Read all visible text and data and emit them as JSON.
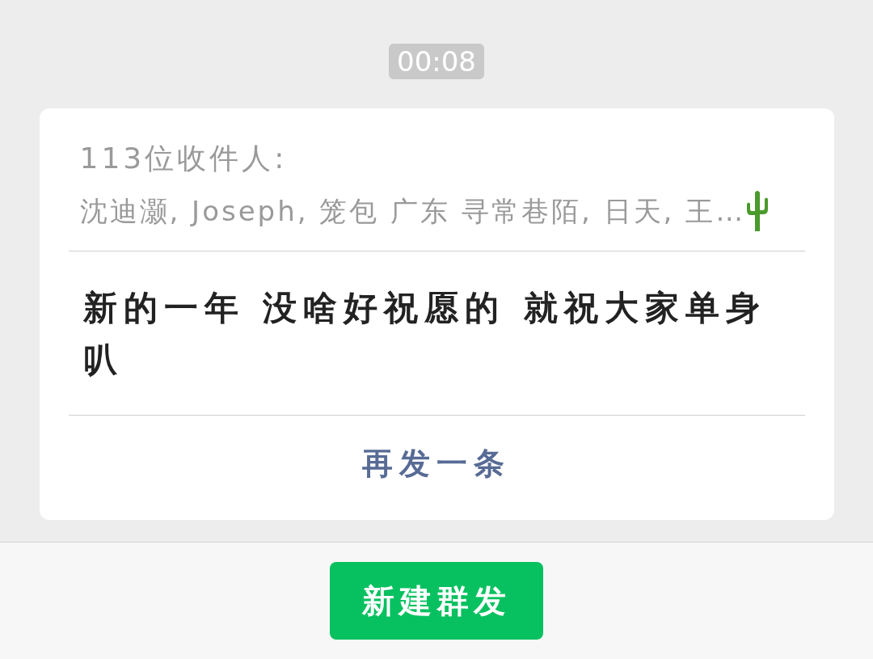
{
  "time": "00:08",
  "message_card": {
    "recipients_label": "113位收件人:",
    "recipients": "沈迪灏, Joseph, 笼包 广东 寻常巷陌, 日天, 王…",
    "message": "新的一年 没啥好祝愿的 就祝大家单身叭",
    "resend_link": "再发一条"
  },
  "bottom_bar": {
    "button": "新建群发"
  }
}
